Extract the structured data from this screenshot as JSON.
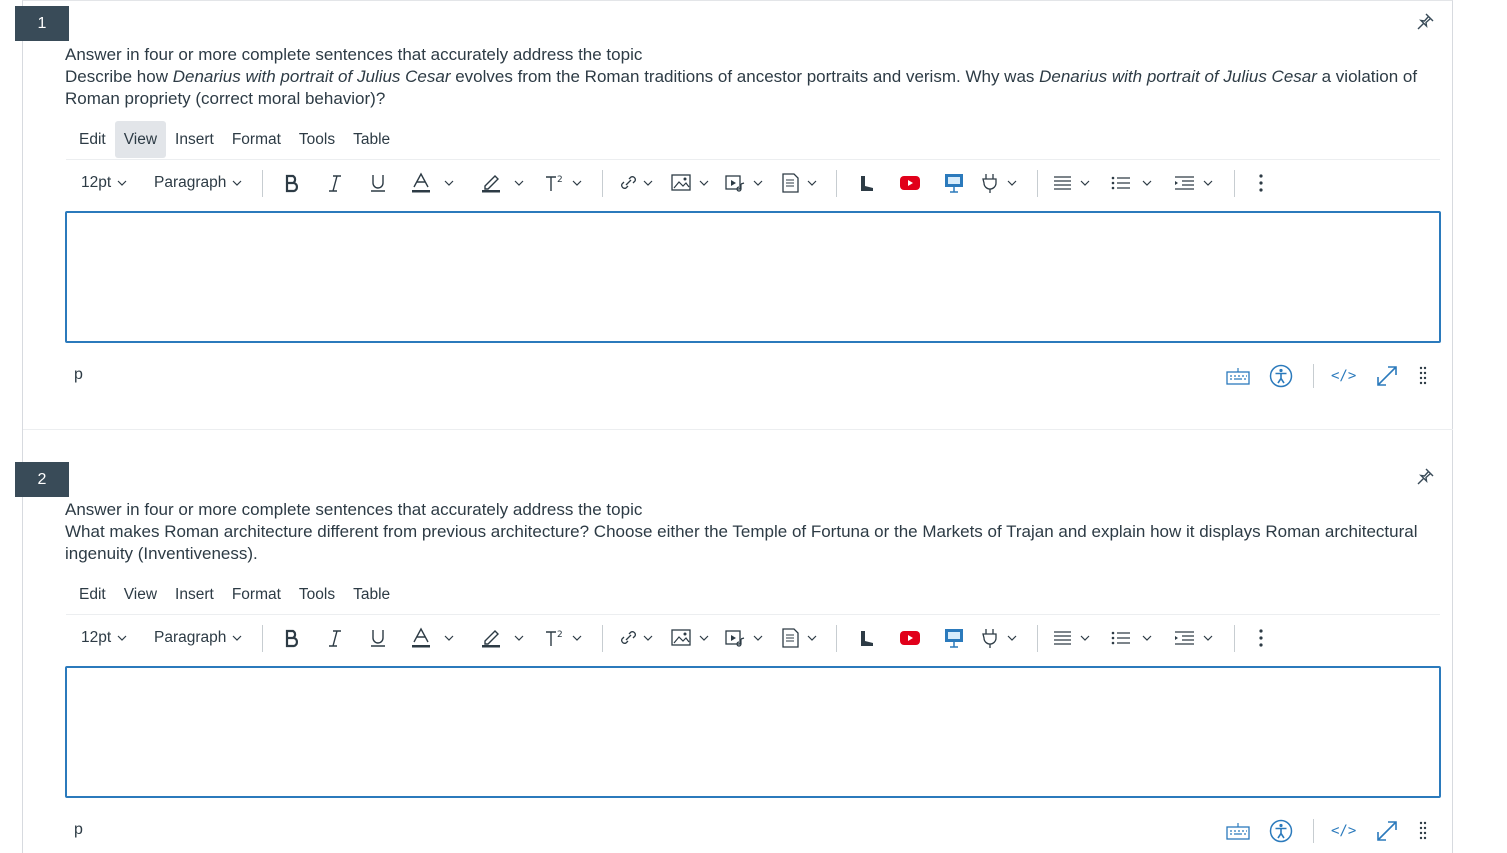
{
  "questions": [
    {
      "number": "1",
      "prompt": "Answer in four or more complete sentences that accurately address the topic",
      "body_parts": [
        {
          "text": "Describe how ",
          "italic": false
        },
        {
          "text": "Denarius with portrait of Julius Cesar",
          "italic": true
        },
        {
          "text": " evolves from the Roman traditions of ancestor portraits and verism. Why was ",
          "italic": false
        },
        {
          "text": "Denarius with portrait of Julius Cesar",
          "italic": true
        },
        {
          "text": " a violation of Roman propriety (correct moral behavior)?",
          "italic": false
        }
      ],
      "active_menu": "View",
      "answer": "",
      "path": "p"
    },
    {
      "number": "2",
      "prompt": "Answer in four or more complete sentences that accurately address the topic",
      "body_parts": [
        {
          "text": "What makes Roman architecture different from previous architecture?  Choose either the Temple of Fortuna or the Markets of Trajan and explain how it displays Roman architectural ingenuity (Inventiveness).",
          "italic": false
        }
      ],
      "active_menu": "",
      "answer": "",
      "path": "p"
    }
  ],
  "editor": {
    "menus": [
      "Edit",
      "View",
      "Insert",
      "Format",
      "Tools",
      "Table"
    ],
    "font_size": "12pt",
    "block_format": "Paragraph",
    "html_toggle": "</>",
    "toolbar_icons": [
      "bold-icon",
      "italic-icon",
      "underline-icon",
      "text-color-icon",
      "highlight-icon",
      "superscript-icon",
      "link-icon",
      "image-icon",
      "media-icon",
      "document-icon",
      "studio-icon",
      "youtube-icon",
      "apps-icon",
      "plugin-icon",
      "align-icon",
      "bullet-list-icon",
      "indent-icon",
      "more-icon"
    ],
    "status_icons": [
      "keyboard-icon",
      "accessibility-icon",
      "html-editor-icon",
      "fullscreen-icon",
      "resize-handle-icon"
    ]
  },
  "colors": {
    "number_badge": "#394b58",
    "editor_border": "#2b7abc",
    "active_menu_bg": "#e2e5e9",
    "youtube_red": "#e1001a",
    "accent_blue": "#2b7abc",
    "text": "#2d3b45"
  }
}
